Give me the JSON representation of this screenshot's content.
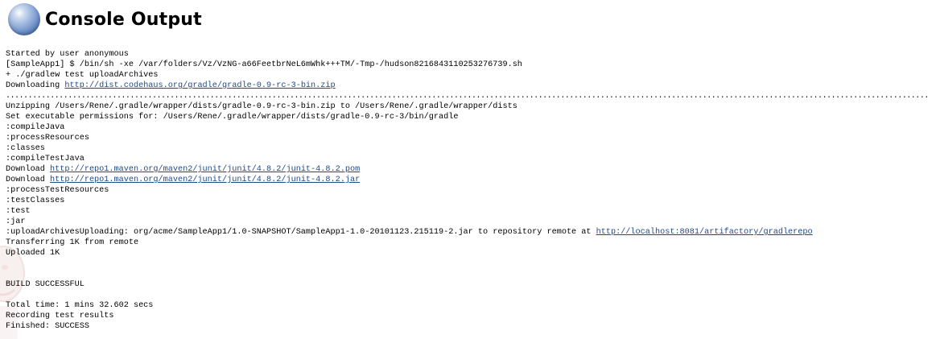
{
  "header": {
    "title": "Console Output",
    "icon": "console-globe-icon"
  },
  "console": {
    "lines": [
      {
        "text": "Started by user anonymous"
      },
      {
        "text": "[SampleApp1] $ /bin/sh -xe /var/folders/Vz/VzNG-a66FeetbrNeL6mWhk+++TM/-Tmp-/hudson8216843110253276739.sh"
      },
      {
        "text": "+ ./gradlew test uploadArchives"
      },
      {
        "text": "Downloading ",
        "link": "http://dist.codehaus.org/gradle/gradle-0.9-rc-3-bin.zip"
      },
      {
        "text": "................................................................................................................................................................................................................"
      },
      {
        "text": "Unzipping /Users/Rene/.gradle/wrapper/dists/gradle-0.9-rc-3-bin.zip to /Users/Rene/.gradle/wrapper/dists"
      },
      {
        "text": "Set executable permissions for: /Users/Rene/.gradle/wrapper/dists/gradle-0.9-rc-3/bin/gradle"
      },
      {
        "text": ":compileJava"
      },
      {
        "text": ":processResources"
      },
      {
        "text": ":classes"
      },
      {
        "text": ":compileTestJava"
      },
      {
        "text": "Download ",
        "link": "http://repo1.maven.org/maven2/junit/junit/4.8.2/junit-4.8.2.pom"
      },
      {
        "text": "Download ",
        "link": "http://repo1.maven.org/maven2/junit/junit/4.8.2/junit-4.8.2.jar"
      },
      {
        "text": ":processTestResources"
      },
      {
        "text": ":testClasses"
      },
      {
        "text": ":test"
      },
      {
        "text": ":jar"
      },
      {
        "text": ":uploadArchivesUploading: org/acme/SampleApp1/1.0-SNAPSHOT/SampleApp1-1.0-20101123.215119-2.jar to repository remote at ",
        "link": "http://localhost:8081/artifactory/gradlerepo"
      },
      {
        "text": "Transferring 1K from remote"
      },
      {
        "text": "Uploaded 1K"
      },
      {
        "text": ""
      },
      {
        "text": ""
      },
      {
        "text": "BUILD SUCCESSFUL"
      },
      {
        "text": ""
      },
      {
        "text": "Total time: 1 mins 32.602 secs"
      },
      {
        "text": "Recording test results"
      },
      {
        "text": "Finished: SUCCESS"
      }
    ]
  },
  "colors": {
    "link": "#204a87",
    "text": "#000000",
    "background": "#ffffff"
  }
}
